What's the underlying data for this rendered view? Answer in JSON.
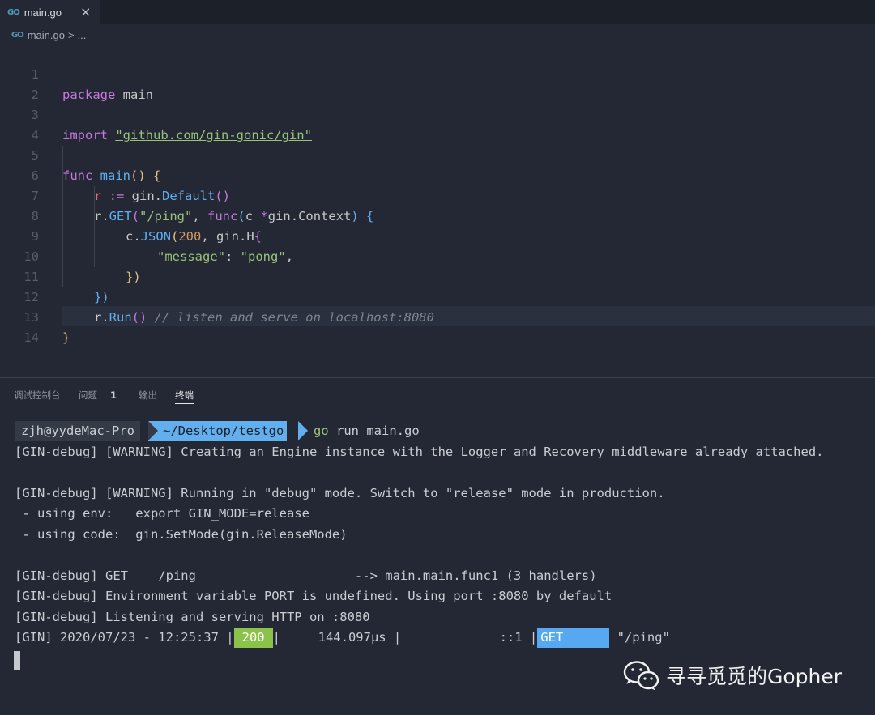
{
  "tab": {
    "icon": "go-file-icon",
    "icon_text": "GO",
    "label": "main.go",
    "close": "×"
  },
  "breadcrumb": {
    "icon_text": "GO",
    "file": "main.go",
    "sep": ">",
    "more": "..."
  },
  "editor": {
    "line_numbers": [
      "1",
      "2",
      "3",
      "4",
      "5",
      "6",
      "7",
      "8",
      "9",
      "10",
      "11",
      "12",
      "13",
      "14"
    ],
    "tokens": {
      "l1_package": "package",
      "l1_main": " main",
      "l3_import": "import",
      "l3_sp": " ",
      "l3_path": "\"github.com/gin-gonic/gin\"",
      "l5_func": "func",
      "l5_name": " main",
      "l5_parens": "()",
      "l5_sp": " ",
      "l5_brace": "{",
      "l6_r": "r",
      "l6_op": " :=",
      "l6_gin": " gin.",
      "l6_default": "Default",
      "l6_parens": "()",
      "l7_r": "r.",
      "l7_get": "GET",
      "l7_open": "(",
      "l7_path": "\"/ping\"",
      "l7_comma": ", ",
      "l7_func": "func",
      "l7_paren": "(",
      "l7_params": "c ",
      "l7_star": "*",
      "l7_type": "gin.Context",
      "l7_close": ")",
      "l7_sp": " ",
      "l7_brace": "{",
      "l8_c": "c.",
      "l8_json": "JSON",
      "l8_open": "(",
      "l8_num": "200",
      "l8_rest": ", gin.H",
      "l8_brace": "{",
      "l9_key": "\"message\"",
      "l9_colon": ": ",
      "l9_val": "\"pong\"",
      "l9_comma": ",",
      "l10_close": "})",
      "l11_close": "})",
      "l12_r": "r.",
      "l12_run": "Run",
      "l12_parens": "()",
      "l12_comment": " // listen and serve on localhost:8080",
      "l13_close": "}"
    }
  },
  "panel": {
    "tabs": [
      "调试控制台",
      "问题",
      "输出",
      "终端"
    ],
    "problems_count": "1",
    "active_tab": "终端"
  },
  "terminal": {
    "prompt_user": "zjh@yydeMac-Pro",
    "prompt_path": "~/Desktop/testgo",
    "cmd_go": "go",
    "cmd_run": " run ",
    "cmd_file": "main.go",
    "lines": [
      "[GIN-debug] [WARNING] Creating an Engine instance with the Logger and Recovery middleware already attached.",
      "",
      "[GIN-debug] [WARNING] Running in \"debug\" mode. Switch to \"release\" mode in production.",
      " - using env:   export GIN_MODE=release",
      " - using code:  gin.SetMode(gin.ReleaseMode)",
      "",
      "[GIN-debug] GET    /ping                     --> main.main.func1 (3 handlers)",
      "[GIN-debug] Environment variable PORT is undefined. Using port :8080 by default",
      "[GIN-debug] Listening and serving HTTP on :8080"
    ],
    "log": {
      "prefix": "[GIN] 2020/07/23 - 12:25:37 |",
      "status": "200",
      "middle": "|     144.097µs |             ::1 |",
      "method": "GET",
      "path": " \"/ping\""
    }
  },
  "watermark": {
    "icon": "wechat-icon",
    "text": "寻寻觅觅的Gopher"
  },
  "colors": {
    "editor_bg": "#232834",
    "tab_bar_bg": "#1c2029",
    "status_200": "#8bc34a",
    "method_get": "#56a8f0",
    "prompt_path_bg": "#61afef"
  }
}
